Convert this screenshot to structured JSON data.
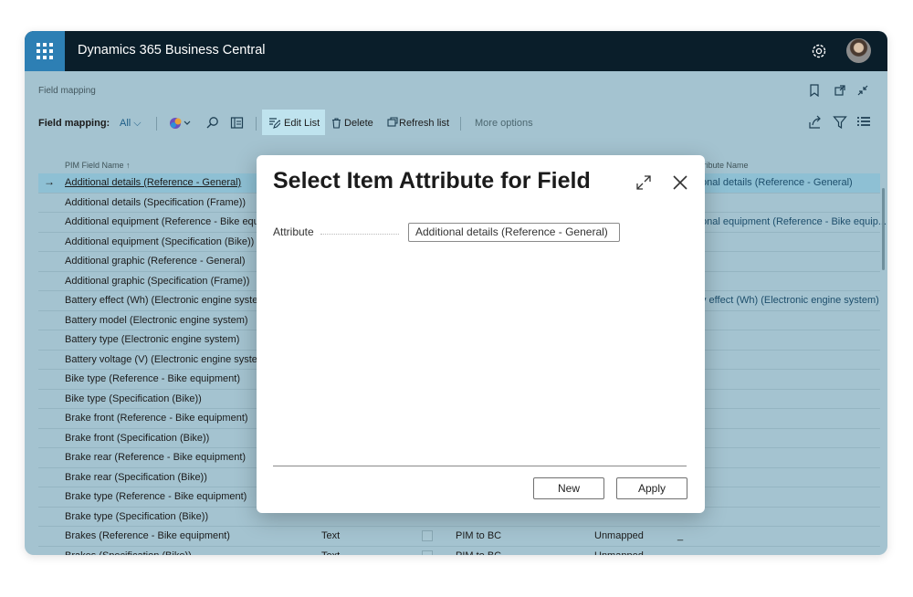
{
  "app": {
    "title": "Dynamics 365 Business Central"
  },
  "page": {
    "title": "Field mapping"
  },
  "actionbar": {
    "label": "Field mapping:",
    "filter": "All",
    "edit_list": "Edit List",
    "delete": "Delete",
    "refresh": "Refresh list",
    "more": "More options"
  },
  "columns": {
    "pim_field": "PIM Field Name ↑",
    "attribute": "tribute Name"
  },
  "rows": [
    {
      "name": "Additional details (Reference - General)",
      "attr": "onal details (Reference - General)"
    },
    {
      "name": "Additional details (Specification (Frame))"
    },
    {
      "name": "Additional equipment (Reference - Bike equi",
      "attr": "onal equipment (Reference - Bike equip..."
    },
    {
      "name": "Additional equipment (Specification (Bike))"
    },
    {
      "name": "Additional graphic (Reference - General)"
    },
    {
      "name": "Additional graphic (Specification (Frame))"
    },
    {
      "name": "Battery effect (Wh) (Electronic engine system",
      "attr": "y effect (Wh) (Electronic engine system)"
    },
    {
      "name": "Battery model (Electronic engine system)"
    },
    {
      "name": "Battery type (Electronic engine system)"
    },
    {
      "name": "Battery voltage (V) (Electronic engine system"
    },
    {
      "name": "Bike type (Reference - Bike equipment)"
    },
    {
      "name": "Bike type (Specification (Bike))"
    },
    {
      "name": "Brake front (Reference - Bike equipment)"
    },
    {
      "name": "Brake front (Specification (Bike))"
    },
    {
      "name": "Brake rear (Reference - Bike equipment)"
    },
    {
      "name": "Brake rear (Specification (Bike))"
    },
    {
      "name": "Brake type (Reference - Bike equipment)"
    },
    {
      "name": "Brake type (Specification (Bike))"
    },
    {
      "name": "Brakes (Reference - Bike equipment)",
      "type": "Text",
      "direction": "PIM to BC",
      "status": "Unmapped",
      "dash": "_"
    },
    {
      "name": "Brakes (Specification (Bike))",
      "type": "Text",
      "direction": "PIM to BC",
      "status": "Unmapped",
      "dash": "_"
    }
  ],
  "dialog": {
    "title": "Select Item Attribute for Field",
    "attribute_label": "Attribute",
    "attribute_value": "Additional details (Reference - General)",
    "new_button": "New",
    "apply_button": "Apply"
  }
}
